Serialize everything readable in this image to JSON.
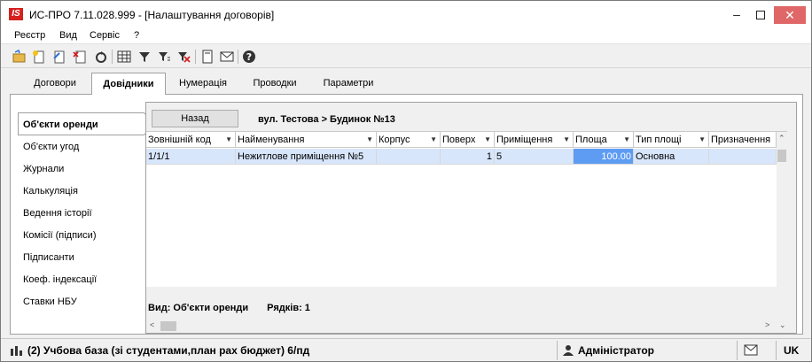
{
  "window": {
    "title": "ИС-ПРО 7.11.028.999 - [Налаштування договорів]",
    "app_icon_text": "IS"
  },
  "menu": [
    "Реєстр",
    "Вид",
    "Сервіс",
    "?"
  ],
  "tabs": [
    {
      "label": "Договори"
    },
    {
      "label": "Довідники",
      "active": true
    },
    {
      "label": "Нумерація"
    },
    {
      "label": "Проводки"
    },
    {
      "label": "Параметри"
    }
  ],
  "sidebar": {
    "items": [
      {
        "label": "Об'єкти оренди",
        "active": true
      },
      {
        "label": "Об'єкти угод"
      },
      {
        "label": "Журнали"
      },
      {
        "label": "Калькуляція"
      },
      {
        "label": "Ведення історії"
      },
      {
        "label": "Комісії (підписи)"
      },
      {
        "label": "Підписанти"
      },
      {
        "label": "Коеф. індексації"
      },
      {
        "label": "Ставки НБУ"
      }
    ]
  },
  "content": {
    "back_label": "Назад",
    "breadcrumb": "вул. Тестова > Будинок №13",
    "columns": [
      "Зовнішній код",
      "Найменування",
      "Корпус",
      "Поверх",
      "Приміщення",
      "Площа",
      "Тип площі",
      "Призначення"
    ],
    "rows": [
      [
        "1/1/1",
        "Нежитлове приміщення №5",
        "",
        "1",
        "5",
        "100.00",
        "Основна",
        ""
      ]
    ],
    "view_label": "Вид: Об'єкти оренди",
    "rows_count_label": "Рядків: 1"
  },
  "statusbar": {
    "database": "(2) Учбова база (зі студентами,план рах бюджет) 6/пд",
    "user": "Адміністратор",
    "language": "UK"
  },
  "colors": {
    "row_bg": "#d8e6fb",
    "selected_cell": "#5e9cf3",
    "close_button": "#e06767"
  }
}
